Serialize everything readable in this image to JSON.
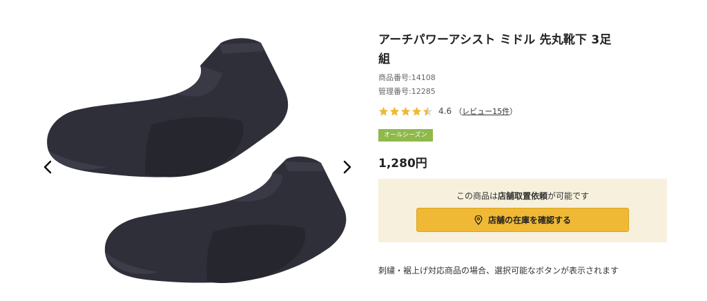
{
  "gallery": {
    "image_alt": "socks-photo",
    "prev_icon": "chevron-left-icon",
    "next_icon": "chevron-right-icon"
  },
  "product": {
    "title": "アーチパワーアシスト ミドル 先丸靴下 3足組",
    "product_no": "商品番号:14108",
    "management_no": "管理番号:12285",
    "rating_value": "4.6",
    "rating_stars": 4.5,
    "review_open": "（",
    "review_link": "レビュー15件",
    "review_close": "）",
    "season_badge": "オールシーズン",
    "price": "1,280円"
  },
  "store": {
    "note_pre": "この商品は",
    "note_bold": "店舗取置依頼",
    "note_post": "が可能です",
    "button_label": "店舗の在庫を確認する",
    "button_icon": "map-pin-icon"
  },
  "notes": {
    "embroidery": "刺繍・裾上げ対応商品の場合、選択可能なボタンが表示されます"
  },
  "colors": {
    "star": "#f0b935",
    "badge": "#8fb94b",
    "store_bg": "#f6f0dd",
    "button": "#f0b935",
    "sock": "#2e2e38"
  }
}
